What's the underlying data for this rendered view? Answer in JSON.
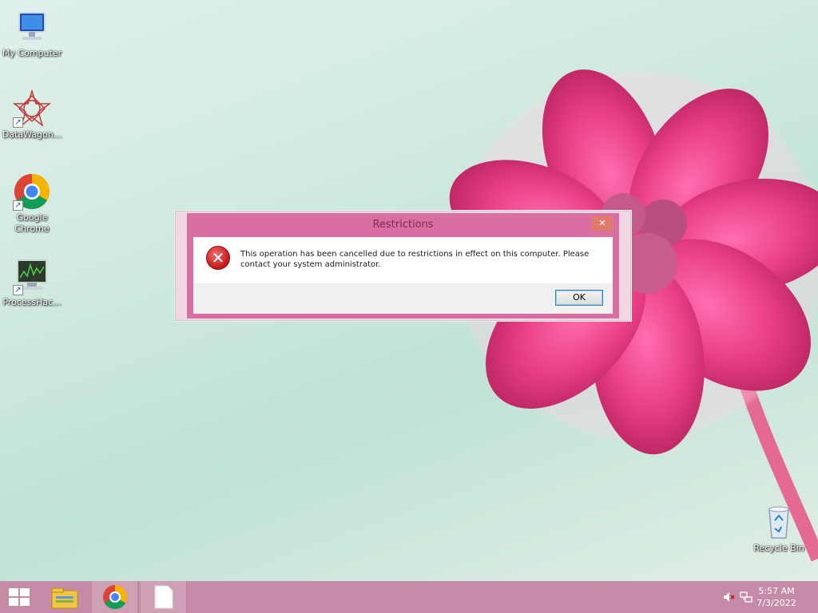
{
  "desktop": {
    "icons": [
      {
        "label": "My Computer"
      },
      {
        "label": "DataWagon..."
      },
      {
        "label": "Google\nChrome"
      },
      {
        "label": "ProcessHac..."
      },
      {
        "label": "Recycle Bin"
      }
    ]
  },
  "dialog": {
    "title": "Restrictions",
    "message": "This operation has been cancelled due to restrictions in effect on this computer. Please contact your system administrator.",
    "ok_label": "OK",
    "icon": "error-icon"
  },
  "taskbar": {
    "apps": [
      "file-explorer-icon",
      "chrome-icon",
      "blank-document-icon"
    ],
    "time": "5:57 AM",
    "date": "7/3/2022",
    "tray_icons": [
      "volume-muted-icon",
      "network-icon"
    ]
  },
  "colors": {
    "taskbar": "#c58aa6",
    "dialog_frame": "#d86ea2",
    "wallpaper_flower": "#e0467f"
  }
}
